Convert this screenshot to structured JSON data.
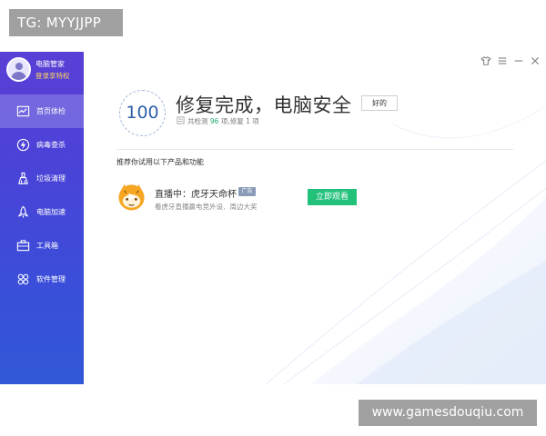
{
  "overlay": {
    "top_tag": "TG: MYYJJPP",
    "bottom_tag": "www.gamesdouqiu.com"
  },
  "profile": {
    "name": "电脑管家",
    "login_link": "登录享特权"
  },
  "sidebar": {
    "items": [
      {
        "label": "首页体检",
        "icon": "pulse-icon",
        "active": true
      },
      {
        "label": "病毒查杀",
        "icon": "lightning-icon",
        "active": false
      },
      {
        "label": "垃圾清理",
        "icon": "broom-icon",
        "active": false
      },
      {
        "label": "电脑加速",
        "icon": "rocket-icon",
        "active": false
      },
      {
        "label": "工具箱",
        "icon": "toolbox-icon",
        "active": false
      },
      {
        "label": "软件管理",
        "icon": "apps-icon",
        "active": false
      }
    ]
  },
  "window_controls": [
    "skin-icon",
    "menu-icon",
    "minimize-icon",
    "close-icon"
  ],
  "status": {
    "score": "100",
    "title": "修复完成，电脑安全",
    "ok_button": "好的",
    "scan_prefix": "共检测",
    "scan_count": "96",
    "scan_middle": "项,修复",
    "fix_count": "1",
    "scan_suffix": "项"
  },
  "recommend": {
    "title": "推荐你试用以下产品和功能",
    "item": {
      "title": "直播中：虎牙天命杯",
      "badge": "广告",
      "desc": "看虎牙直播赢电竞外设、周边大奖",
      "button": "立即观看",
      "icon": "huya-icon"
    }
  },
  "colors": {
    "sidebar_top": "#5a3fd6",
    "sidebar_bottom": "#3158d6",
    "link": "#ffd95a",
    "score": "#2f5fa8",
    "highlight": "#21a868",
    "watch_button": "#22c17a"
  }
}
